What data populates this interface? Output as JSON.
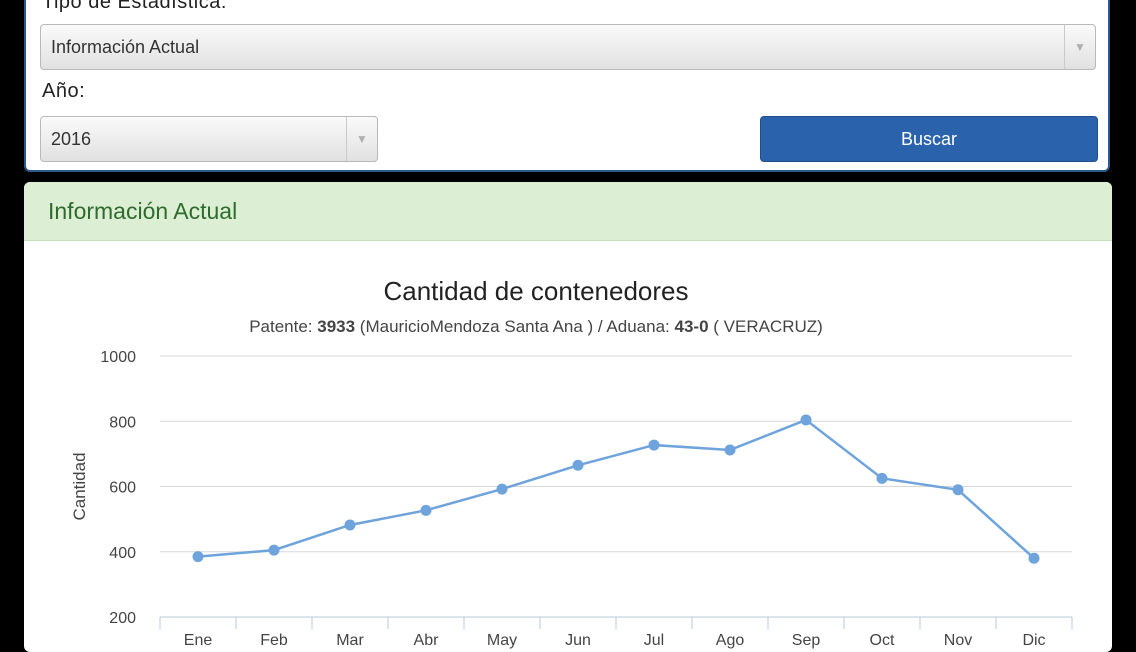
{
  "form": {
    "tipo_label": "Tipo de Estadística:",
    "tipo_value": "Información Actual",
    "anio_label": "Año:",
    "anio_value": "2016",
    "buscar_label": "Buscar"
  },
  "card": {
    "header": "Información Actual"
  },
  "chart_data": {
    "type": "line",
    "title": "Cantidad de contenedores",
    "subtitle_parts": [
      "Patente: ",
      "3933",
      " (MauricioMendoza Santa Ana ) / Aduana: ",
      "43-0",
      " ( VERACRUZ)"
    ],
    "ylabel": "Cantidad",
    "xlabel": "",
    "ylim": [
      200,
      1000
    ],
    "yticks": [
      200,
      400,
      600,
      800,
      1000
    ],
    "grid": true,
    "categories": [
      "Ene",
      "Feb",
      "Mar",
      "Abr",
      "May",
      "Jun",
      "Jul",
      "Ago",
      "Sep",
      "Oct",
      "Nov",
      "Dic"
    ],
    "series": [
      {
        "values": [
          385,
          405,
          482,
          527,
          592,
          665,
          727,
          712,
          804,
          625,
          590,
          380
        ],
        "color": "#6fa3dc"
      }
    ]
  }
}
